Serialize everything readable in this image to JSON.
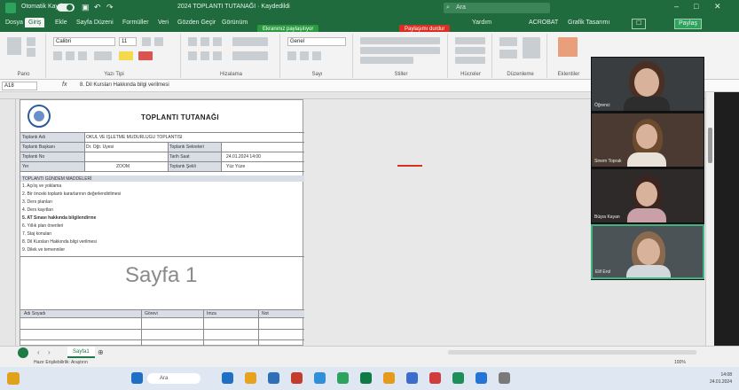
{
  "titlebar": {
    "autosave_label": "Otomatik Kaydet",
    "doc_title": "2024 TOPLANTI TUTANAĞI · Kaydedildi",
    "search_placeholder": "Ara",
    "icons": [
      "save-icon",
      "undo-icon",
      "redo-icon"
    ]
  },
  "tabs": [
    "Dosya",
    "Giriş",
    "Ekle",
    "Sayfa Düzeni",
    "Formüller",
    "Veri",
    "Gözden Geçir",
    "Görünüm",
    "Yardım"
  ],
  "tabs_right": [
    "ACROBAT",
    "Grafik Tasarımı",
    "Paylaş"
  ],
  "recording": {
    "status": "Ekranınız paylaşılıyor",
    "stop_label": "Paylaşımı durdur"
  },
  "ribbon": {
    "groups": [
      "Pano",
      "Yazı Tipi",
      "Hizalama",
      "Sayı",
      "Stiller",
      "Hücreler",
      "Düzenleme",
      "Eklentiler"
    ],
    "font_name": "Calibri",
    "font_size": "11",
    "number_format": "Genel"
  },
  "formula_bar": {
    "name_box": "A18",
    "fx": "fx",
    "formula": "8. Dil Kursları Hakkında bilgi verilmesi"
  },
  "sheet": {
    "title": "TOPLANTI TUTANAĞI",
    "info_rows": [
      {
        "label": "Toplantı Adı",
        "value": "OKUL VE İŞLETME MÜDÜRLÜĞÜ TOPLANTISI"
      },
      {
        "label": "Toplantı Başkanı",
        "value": "Dr. Öğr. Üyesi",
        "label2": "Toplantı Sekreteri",
        "value2": ""
      },
      {
        "label": "Toplantı No",
        "value": "",
        "label2": "Tarih Saat",
        "value2": "24.01.2024 14:00"
      },
      {
        "label": "Yer",
        "value": "ZOOM",
        "label2": "Toplantı Şekli",
        "value2": "Yüz Yüze"
      }
    ],
    "agenda_title": "TOPLANTI GÜNDEM MADDELERİ",
    "agenda_items": [
      "1. Açılış ve yoklama",
      "2. Bir önceki toplantı kararlarının değerlendirilmesi",
      "3. Ders planları",
      "4. Ders kayıtları",
      "5. AT Sınavı hakkında bilgilendirme",
      "6. Yıllık plan önerileri",
      "7. Staj konuları",
      "8. Dil Kursları Hakkında bilgi verilmesi",
      "9. Dilek ve temenniler"
    ],
    "watermark": "Sayfa 1",
    "bottom_headers": [
      "Adı Soyadı",
      "Görevi",
      "İmza",
      "Not"
    ]
  },
  "sheet_tab": "Sayfa1",
  "status": "Hazır  Erişilebilirlik: Araştırın",
  "zoom": "100%",
  "taskbar": {
    "search_placeholder": "Ara",
    "time": "14:08",
    "date": "24.01.2024",
    "icon_colors": [
      "#1f6fc7",
      "#e8a31e",
      "#2f6fb7",
      "#c43c2c",
      "#2f8fd8",
      "#2ea35e",
      "#0f7a45",
      "#e59a1b",
      "#3c6dcc",
      "#d13c3c",
      "#1f8f5a",
      "#2574d8",
      "#7a7a7a"
    ]
  },
  "call": {
    "participants": [
      {
        "name": "Öğrenci",
        "active": false
      },
      {
        "name": "Sinem Toprak",
        "active": false
      },
      {
        "name": "Büşra Kayan",
        "active": false
      },
      {
        "name": "Elif Erol",
        "active": true
      }
    ]
  }
}
